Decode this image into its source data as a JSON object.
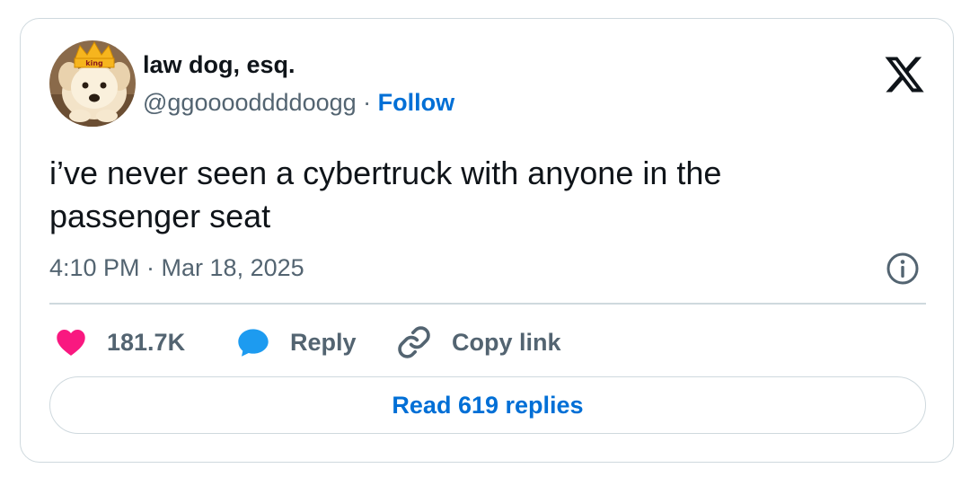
{
  "colors": {
    "accent": "#006fd6",
    "like": "#f91880",
    "reply": "#1d9bf0",
    "text_primary": "#0f1419",
    "text_secondary": "#536471",
    "border": "#cfd9de"
  },
  "author": {
    "display_name": "law dog, esq.",
    "handle": "@ggooooddddoogg",
    "separator": " · ",
    "follow_label": "Follow",
    "avatar": {
      "icon": "dog-with-crown-avatar",
      "crown_text": "king"
    }
  },
  "header": {
    "logo_icon": "x-logo-icon"
  },
  "tweet": {
    "text": "i’ve never seen a cybertruck with anyone in the\npassenger seat",
    "timestamp": "4:10 PM · Mar 18, 2025",
    "info_icon": "info-icon"
  },
  "actions": {
    "like_count": "181.7K",
    "reply_label": "Reply",
    "copy_link_label": "Copy link"
  },
  "footer": {
    "read_replies_label": "Read 619 replies"
  }
}
